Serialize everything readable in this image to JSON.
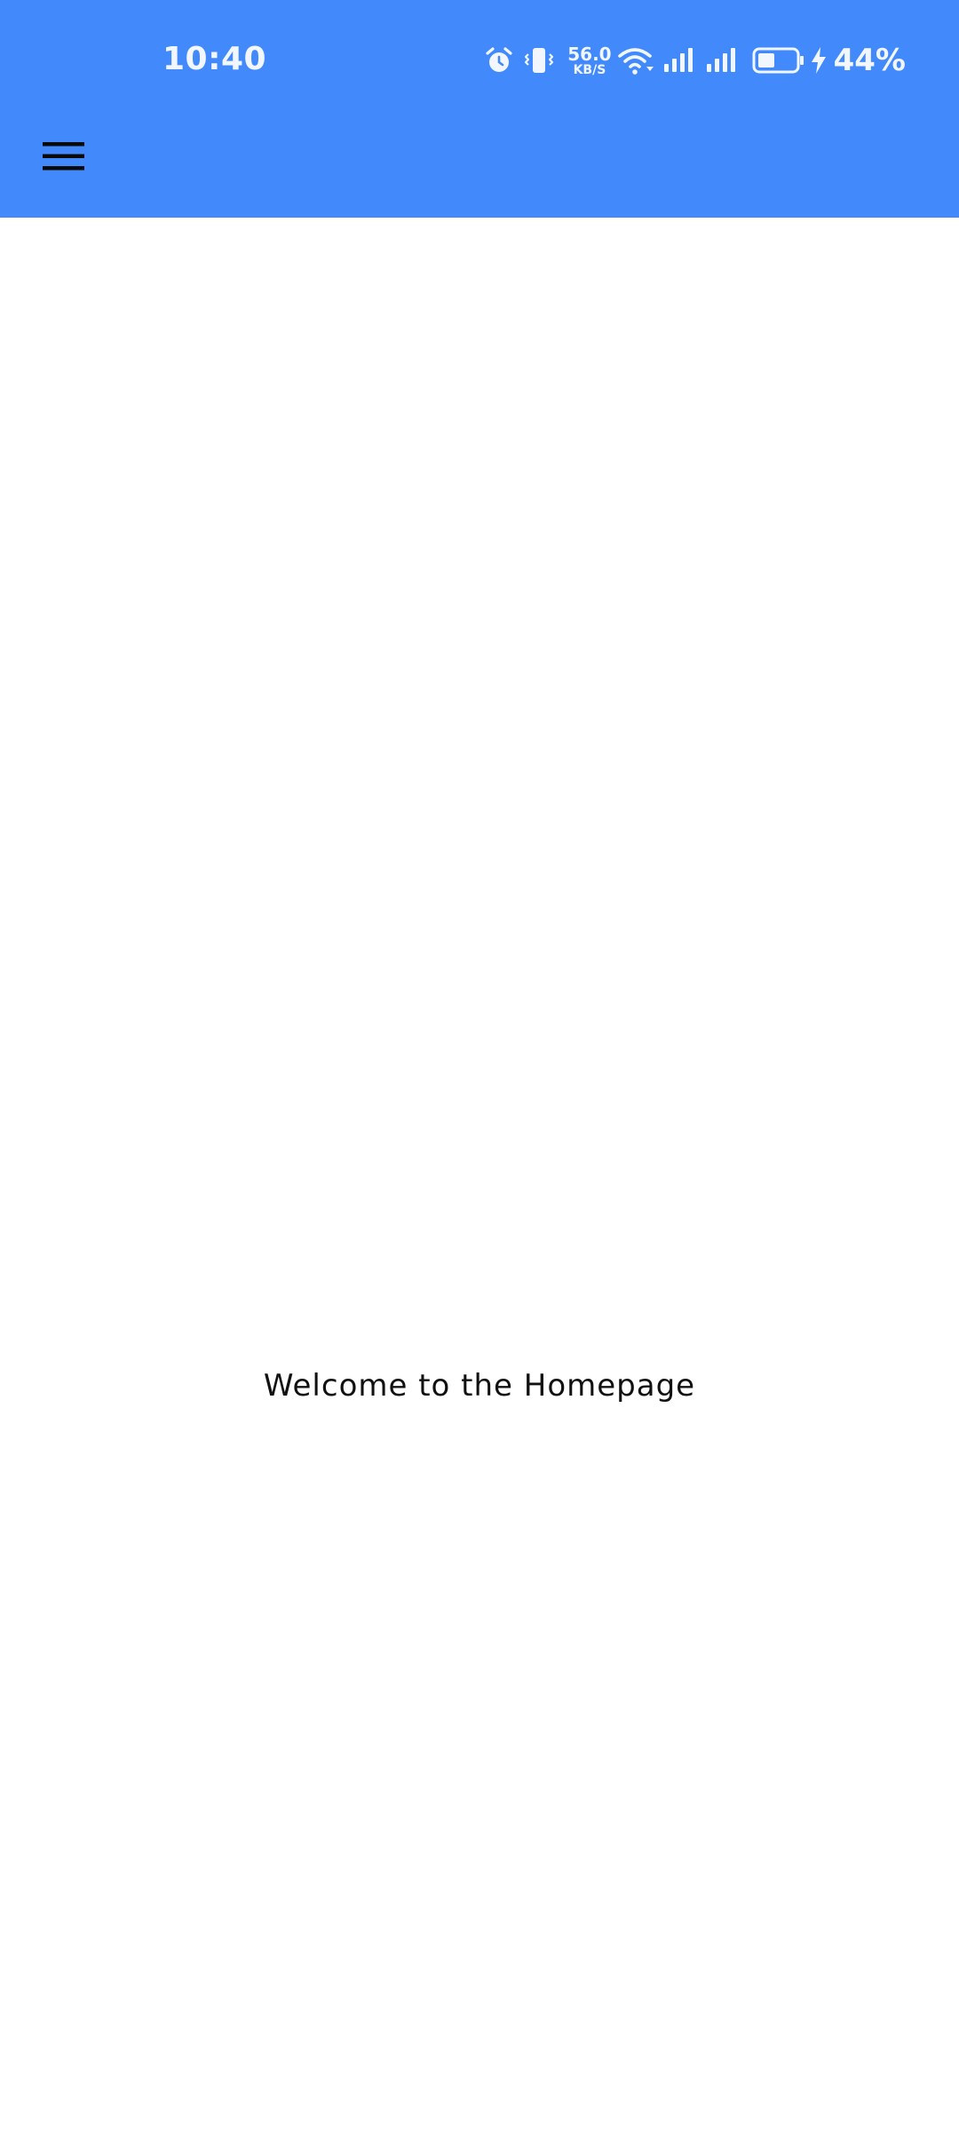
{
  "status_bar": {
    "time": "10:40",
    "network_speed_value": "56.0",
    "network_speed_unit": "KB/S",
    "battery_percent": "44%",
    "battery_level": 0.44,
    "icons": [
      "alarm-icon",
      "vibrate-icon",
      "wifi-icon",
      "signal-icon",
      "signal-icon",
      "battery-icon",
      "charging-icon"
    ]
  },
  "app_bar": {
    "menu_icon": "hamburger-menu-icon",
    "background_color": "#428AFC"
  },
  "main": {
    "welcome_text": "Welcome to the Homepage"
  }
}
